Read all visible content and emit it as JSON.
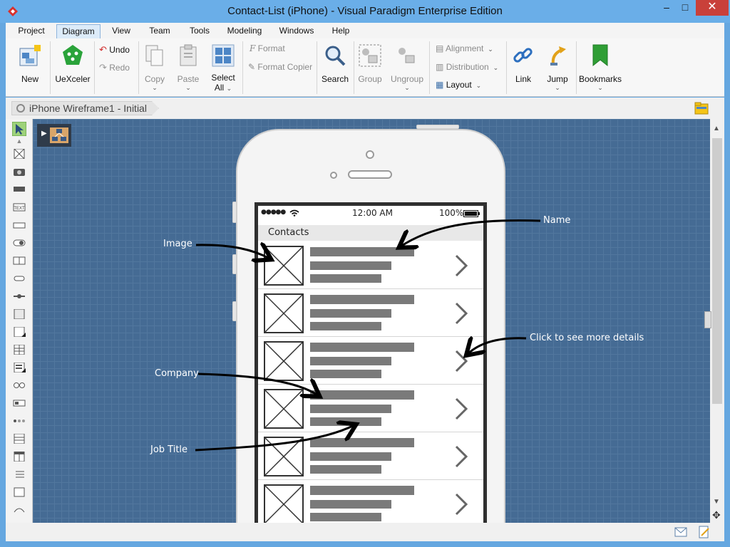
{
  "window": {
    "title": "Contact-List (iPhone) - Visual Paradigm Enterprise Edition",
    "minimize_glyph": "–",
    "maximize_glyph": "□",
    "close_glyph": "✕"
  },
  "menu": {
    "tabs": [
      "Project",
      "Diagram",
      "View",
      "Team",
      "Tools",
      "Modeling",
      "Windows",
      "Help"
    ],
    "active": "Diagram"
  },
  "ribbon": {
    "new": "New",
    "uexceler": "UeXceler",
    "undo": "Undo",
    "redo": "Redo",
    "copy": "Copy",
    "paste": "Paste",
    "select_all_1": "Select",
    "select_all_2": "All",
    "format": "Format",
    "format_copier": "Format Copier",
    "search": "Search",
    "group": "Group",
    "ungroup": "Ungroup",
    "alignment": "Alignment",
    "distribution": "Distribution",
    "layout": "Layout",
    "link": "Link",
    "jump": "Jump",
    "bookmarks": "Bookmarks"
  },
  "breadcrumb": {
    "label": "iPhone Wireframe1 - Initial"
  },
  "phone": {
    "time": "12:00 AM",
    "battery": "100%",
    "nav_title": "Contacts",
    "row_count_visible": 6
  },
  "annotations": {
    "name": "Name",
    "image": "Image",
    "click_details": "Click to see more details",
    "company": "Company",
    "job_title": "Job Title"
  },
  "colors": {
    "canvas": "#456b94",
    "titlebar": "#6aaee8",
    "close_button": "#c9403a",
    "uexceler_green": "#2aa33a",
    "bookmark_green": "#2f9e35"
  }
}
